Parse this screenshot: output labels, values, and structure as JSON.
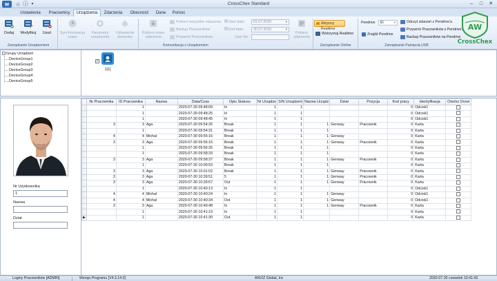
{
  "window": {
    "title": "CrossChex Standard",
    "minimize": "–",
    "maximize": "□",
    "close": "✕"
  },
  "tabs": [
    {
      "label": "Ustawienia"
    },
    {
      "label": "Pracownicy"
    },
    {
      "label": "Urządzenia"
    },
    {
      "label": "Zdarzenia"
    },
    {
      "label": "Obecność"
    },
    {
      "label": "Dane"
    },
    {
      "label": "Pomoc"
    }
  ],
  "ribbon": {
    "group1": {
      "label": "Zarządzanie Urządzeniem",
      "add": "Dodaj",
      "modify": "Modyfikuj",
      "delete": "Usuń"
    },
    "group2": {
      "label": "Komunikacja z Urządzeniem",
      "sync_time": "Synchronizacja czasu",
      "device_params": "Parametry urządzenia",
      "bell_settings": "Ustawienia dzwonka",
      "download_new": "Pobierz nowe zdarzenia",
      "download_all": "Pobierz wszystkie zdarzenia",
      "backup_employees": "Backup Pracowników",
      "restore_employees": "Przywróć Pracowników",
      "start_date_label": "Start date:",
      "start_date": "01.07.2020",
      "end_date_label": "End date:",
      "end_date": "30.07.2020",
      "user_no_label": "User No.:",
      "user_no": "",
      "download_events": "Pobierz zdarzenia"
    },
    "group3": {
      "label": "Zarządzanie Online",
      "realtime_on": "Aktywny Realtime",
      "realtime_stop": "Wstrzymaj Realtime"
    },
    "group4": {
      "label": "Zarządzanie Pamięcią USB",
      "pendrive_label": "Pendrive",
      "pendrive_value": "E\\",
      "find_pendrive": "Znajdź Pendrive",
      "read_events": "Odczyt zdarzeń z Pendrive'a",
      "restore_from": "Przywróć Pracowników z Pendrive'a",
      "backup_to": "Backup Pracowników na Pendrive"
    },
    "logo_text": "CrossChex",
    "logo_badge": "AW",
    "brand_color": "#2f9b4e"
  },
  "tree": {
    "root": "Grupy Urządzeń",
    "items": [
      "DeviceGroup1",
      "DeviceGroup2",
      "DeviceGroup3",
      "DeviceGroup4",
      "DeviceGroup5"
    ]
  },
  "devices": [
    {
      "label": "1[1]",
      "checked": true
    }
  ],
  "employee_panel": {
    "id_label": "Nr Użytkownika",
    "id_value": "1",
    "name_label": "Nazwa",
    "name_value": "",
    "dept_label": "Dział",
    "dept_value": ""
  },
  "grid": {
    "columns": [
      "Nr Pracownika",
      "ID Pracownika",
      "Nazwa",
      "Data/Czas",
      "Opis Statusu",
      "Nr Urządze",
      "S/N Urządzeni",
      "Nazwa Urządz",
      "Dział",
      "Pozycja",
      "Kod pracy",
      "Identyfikacja",
      "Otwórz Drzwi"
    ],
    "rows": [
      [
        "",
        "1",
        "",
        "2020-07-30 09:48:09",
        "In",
        "1",
        "1",
        "",
        "",
        "",
        "0",
        "Odcisk1"
      ],
      [
        "",
        "1",
        "",
        "2020-07-30 09:48:25",
        "In",
        "1",
        "1",
        "",
        "",
        "",
        "0",
        "Odcisk1"
      ],
      [
        "",
        "1",
        "",
        "2020-07-30 09:48:45",
        "In",
        "1",
        "1",
        "",
        "",
        "",
        "0",
        "Odcisk1"
      ],
      [
        "3",
        "3",
        "Aga",
        "2020-07-30 09:54:26",
        "Break",
        "1",
        "1",
        "1",
        "Genway",
        "Pracownik",
        "0",
        "Karta"
      ],
      [
        "",
        "1",
        "",
        "2020-07-30 09:54:31",
        "Break",
        "1",
        "1",
        "1",
        "",
        "",
        "0",
        "Karta"
      ],
      [
        "4",
        "4",
        "Michal",
        "2020-07-30 09:55:16",
        "Break",
        "1",
        "1",
        "1",
        "Genway",
        "",
        "0",
        "Karta"
      ],
      [
        "3",
        "3",
        "Aga",
        "2020-07-30 09:56:16",
        "Break",
        "1",
        "1",
        "1",
        "Genway",
        "Pracownik",
        "0",
        "Karta"
      ],
      [
        "",
        "1",
        "",
        "2020-07-30 09:56:26",
        "Break",
        "1",
        "1",
        "1",
        "",
        "",
        "0",
        "Karta"
      ],
      [
        "",
        "1",
        "",
        "2020-07-30 09:58:33",
        "Break",
        "1",
        "1",
        "1",
        "",
        "",
        "0",
        "Karta"
      ],
      [
        "3",
        "3",
        "Aga",
        "2020-07-30 09:58:37",
        "Break",
        "1",
        "1",
        "1",
        "Genway",
        "Pracownik",
        "0",
        "Karta"
      ],
      [
        "",
        "1",
        "",
        "2020-07-30 10:00:53",
        "Break",
        "1",
        "1",
        "1",
        "",
        "",
        "0",
        "Karta"
      ],
      [
        "3",
        "3",
        "Aga",
        "2020-07-30 10:01:02",
        "Break",
        "1",
        "1",
        "1",
        "Genway",
        "Pracownik",
        "0",
        "Karta"
      ],
      [
        "3",
        "3",
        "Aga",
        "2020-07-30 10:39:51",
        "5",
        "1",
        "1",
        "1",
        "Genway",
        "Pracownik",
        "0",
        "Karta"
      ],
      [
        "3",
        "3",
        "Aga",
        "2020-07-30 10:39:57",
        "Out",
        "1",
        "1",
        "1",
        "Genway",
        "Pracownik",
        "0",
        "Karta"
      ],
      [
        "",
        "1",
        "",
        "2020-07-30 10:40:13",
        "In",
        "1",
        "1",
        "",
        "",
        "",
        "0",
        "Odcisk1"
      ],
      [
        "4",
        "4",
        "Michal",
        "2020-07-30 10:40:24",
        "In",
        "1",
        "1",
        "1",
        "Genway",
        "",
        "0",
        "Odcisk1"
      ],
      [
        "4",
        "4",
        "Michal",
        "2020-07-30 10:40:34",
        "Out",
        "1",
        "1",
        "1",
        "Genway",
        "",
        "0",
        "Odcisk1"
      ],
      [
        "3",
        "3",
        "Aga",
        "2020-07-30 10:40:48",
        "In",
        "1",
        "1",
        "1",
        "Genway",
        "Pracownik",
        "0",
        "Karta"
      ],
      [
        "",
        "1",
        "",
        "2020-07-30 10:41:19",
        "In",
        "1",
        "1",
        "",
        "",
        "",
        "0",
        "Karta"
      ],
      [
        "",
        "1",
        "",
        "2020-07-30 10:41:30",
        "Out",
        "1",
        "1",
        "",
        "",
        "",
        "0",
        "Karta"
      ]
    ],
    "current_row_marker": "▶"
  },
  "statusbar": {
    "user": "Loginy Pracowników [ADMIN]",
    "version": "Wersja Programu [V4.3.14.0]",
    "company": "ANVIZ Global, Inc",
    "datetime": "2020-07-30 czwartek 10:41:43"
  }
}
